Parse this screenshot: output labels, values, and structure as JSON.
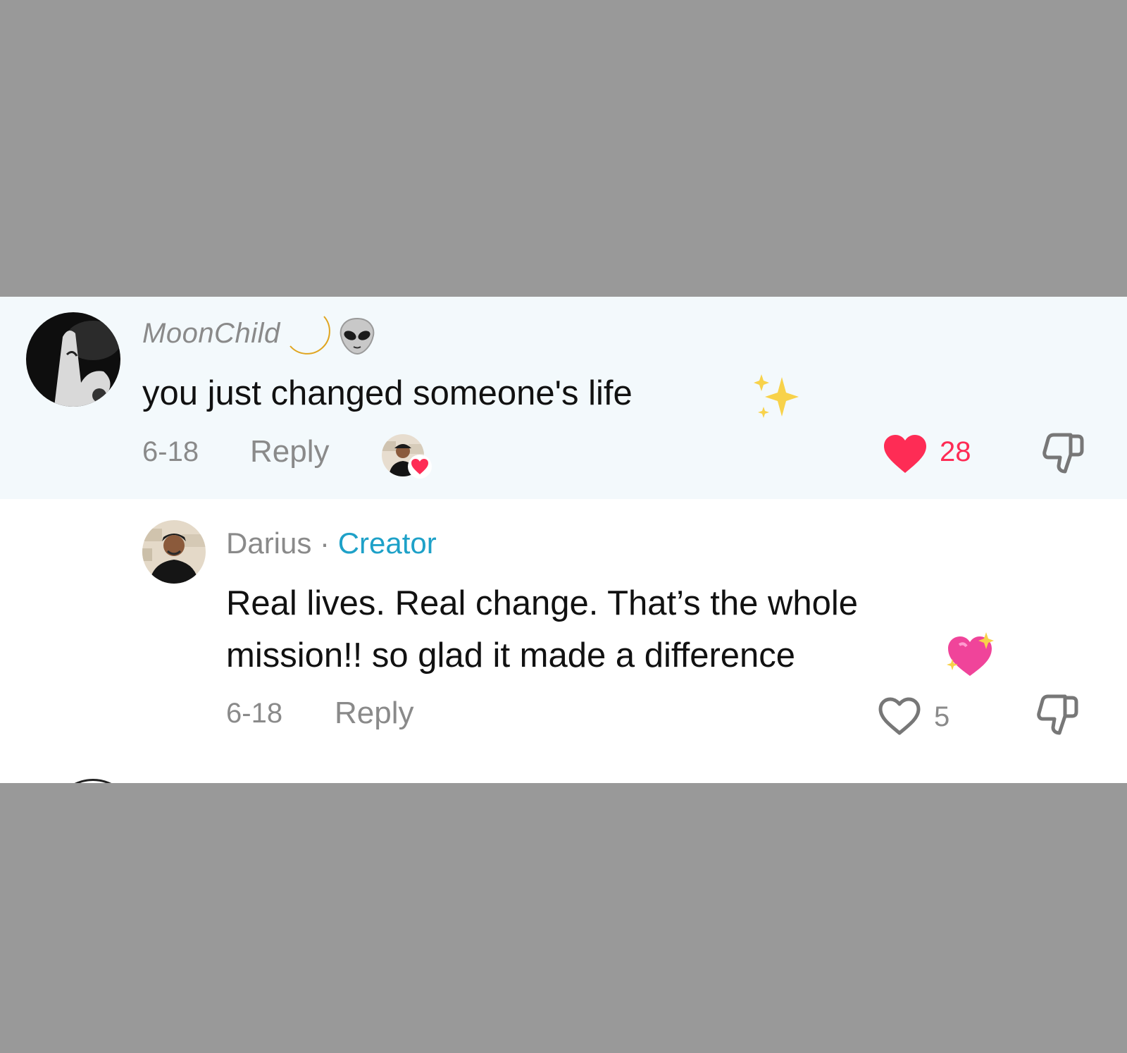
{
  "comment": {
    "username": "MoonChild",
    "username_icons": [
      "crescent-moon-icon",
      "alien-icon"
    ],
    "text": "you just changed someone's life",
    "text_icon": "sparkles-icon",
    "date": "6-18",
    "reply_label": "Reply",
    "liked_by_creator_icon": "creator-liked-avatar",
    "like_count": "28",
    "liked": true,
    "accent_color": "#fe2c55"
  },
  "reply": {
    "username": "Darius",
    "separator": "·",
    "role": "Creator",
    "role_color": "#1ea1c8",
    "text_line1": "Real lives. Real change. That’s the whole",
    "text_line2": "mission!!  so glad it made a difference",
    "text_icon": "sparkling-heart-icon",
    "date": "6-18",
    "reply_label": "Reply",
    "like_count": "5",
    "liked": false
  }
}
